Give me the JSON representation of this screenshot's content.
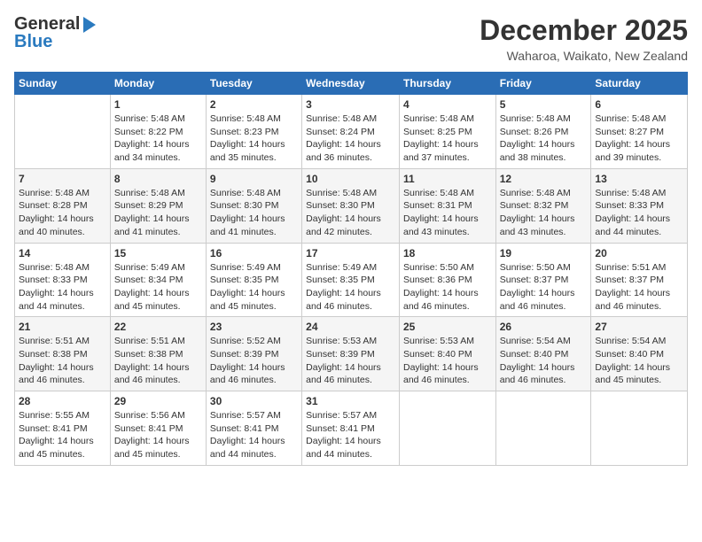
{
  "header": {
    "logo_general": "General",
    "logo_blue": "Blue",
    "month_title": "December 2025",
    "location": "Waharoa, Waikato, New Zealand"
  },
  "days_of_week": [
    "Sunday",
    "Monday",
    "Tuesday",
    "Wednesday",
    "Thursday",
    "Friday",
    "Saturday"
  ],
  "weeks": [
    [
      {
        "day": "",
        "sunrise": "",
        "sunset": "",
        "daylight": ""
      },
      {
        "day": "1",
        "sunrise": "5:48 AM",
        "sunset": "8:22 PM",
        "daylight": "14 hours and 34 minutes."
      },
      {
        "day": "2",
        "sunrise": "5:48 AM",
        "sunset": "8:23 PM",
        "daylight": "14 hours and 35 minutes."
      },
      {
        "day": "3",
        "sunrise": "5:48 AM",
        "sunset": "8:24 PM",
        "daylight": "14 hours and 36 minutes."
      },
      {
        "day": "4",
        "sunrise": "5:48 AM",
        "sunset": "8:25 PM",
        "daylight": "14 hours and 37 minutes."
      },
      {
        "day": "5",
        "sunrise": "5:48 AM",
        "sunset": "8:26 PM",
        "daylight": "14 hours and 38 minutes."
      },
      {
        "day": "6",
        "sunrise": "5:48 AM",
        "sunset": "8:27 PM",
        "daylight": "14 hours and 39 minutes."
      }
    ],
    [
      {
        "day": "7",
        "sunrise": "5:48 AM",
        "sunset": "8:28 PM",
        "daylight": "14 hours and 40 minutes."
      },
      {
        "day": "8",
        "sunrise": "5:48 AM",
        "sunset": "8:29 PM",
        "daylight": "14 hours and 41 minutes."
      },
      {
        "day": "9",
        "sunrise": "5:48 AM",
        "sunset": "8:30 PM",
        "daylight": "14 hours and 41 minutes."
      },
      {
        "day": "10",
        "sunrise": "5:48 AM",
        "sunset": "8:30 PM",
        "daylight": "14 hours and 42 minutes."
      },
      {
        "day": "11",
        "sunrise": "5:48 AM",
        "sunset": "8:31 PM",
        "daylight": "14 hours and 43 minutes."
      },
      {
        "day": "12",
        "sunrise": "5:48 AM",
        "sunset": "8:32 PM",
        "daylight": "14 hours and 43 minutes."
      },
      {
        "day": "13",
        "sunrise": "5:48 AM",
        "sunset": "8:33 PM",
        "daylight": "14 hours and 44 minutes."
      }
    ],
    [
      {
        "day": "14",
        "sunrise": "5:48 AM",
        "sunset": "8:33 PM",
        "daylight": "14 hours and 44 minutes."
      },
      {
        "day": "15",
        "sunrise": "5:49 AM",
        "sunset": "8:34 PM",
        "daylight": "14 hours and 45 minutes."
      },
      {
        "day": "16",
        "sunrise": "5:49 AM",
        "sunset": "8:35 PM",
        "daylight": "14 hours and 45 minutes."
      },
      {
        "day": "17",
        "sunrise": "5:49 AM",
        "sunset": "8:35 PM",
        "daylight": "14 hours and 46 minutes."
      },
      {
        "day": "18",
        "sunrise": "5:50 AM",
        "sunset": "8:36 PM",
        "daylight": "14 hours and 46 minutes."
      },
      {
        "day": "19",
        "sunrise": "5:50 AM",
        "sunset": "8:37 PM",
        "daylight": "14 hours and 46 minutes."
      },
      {
        "day": "20",
        "sunrise": "5:51 AM",
        "sunset": "8:37 PM",
        "daylight": "14 hours and 46 minutes."
      }
    ],
    [
      {
        "day": "21",
        "sunrise": "5:51 AM",
        "sunset": "8:38 PM",
        "daylight": "14 hours and 46 minutes."
      },
      {
        "day": "22",
        "sunrise": "5:51 AM",
        "sunset": "8:38 PM",
        "daylight": "14 hours and 46 minutes."
      },
      {
        "day": "23",
        "sunrise": "5:52 AM",
        "sunset": "8:39 PM",
        "daylight": "14 hours and 46 minutes."
      },
      {
        "day": "24",
        "sunrise": "5:53 AM",
        "sunset": "8:39 PM",
        "daylight": "14 hours and 46 minutes."
      },
      {
        "day": "25",
        "sunrise": "5:53 AM",
        "sunset": "8:40 PM",
        "daylight": "14 hours and 46 minutes."
      },
      {
        "day": "26",
        "sunrise": "5:54 AM",
        "sunset": "8:40 PM",
        "daylight": "14 hours and 46 minutes."
      },
      {
        "day": "27",
        "sunrise": "5:54 AM",
        "sunset": "8:40 PM",
        "daylight": "14 hours and 45 minutes."
      }
    ],
    [
      {
        "day": "28",
        "sunrise": "5:55 AM",
        "sunset": "8:41 PM",
        "daylight": "14 hours and 45 minutes."
      },
      {
        "day": "29",
        "sunrise": "5:56 AM",
        "sunset": "8:41 PM",
        "daylight": "14 hours and 45 minutes."
      },
      {
        "day": "30",
        "sunrise": "5:57 AM",
        "sunset": "8:41 PM",
        "daylight": "14 hours and 44 minutes."
      },
      {
        "day": "31",
        "sunrise": "5:57 AM",
        "sunset": "8:41 PM",
        "daylight": "14 hours and 44 minutes."
      },
      {
        "day": "",
        "sunrise": "",
        "sunset": "",
        "daylight": ""
      },
      {
        "day": "",
        "sunrise": "",
        "sunset": "",
        "daylight": ""
      },
      {
        "day": "",
        "sunrise": "",
        "sunset": "",
        "daylight": ""
      }
    ]
  ]
}
